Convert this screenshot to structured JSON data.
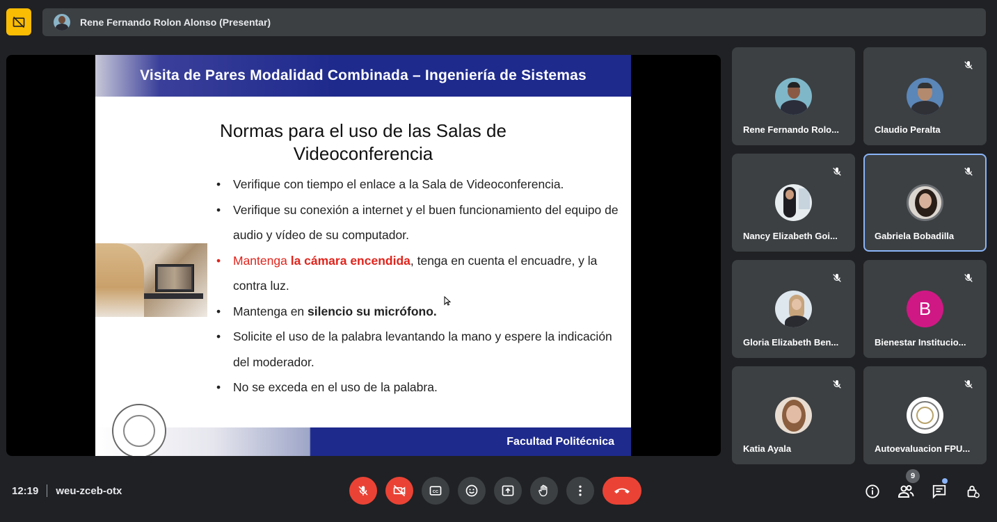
{
  "presenter": {
    "name": "Rene Fernando Rolon Alonso (Presentar)"
  },
  "slide": {
    "header": "Visita de Pares Modalidad Combinada – Ingeniería de Sistemas",
    "title_line1": "Normas para el uso de las Salas de",
    "title_line2": "Videoconferencia",
    "bullets": {
      "b1": "Verifique con tiempo el enlace a la Sala de Videoconferencia.",
      "b2": "Verifique su conexión a internet y el buen funcionamiento del equipo de audio y vídeo de su computador.",
      "b3_part1": "Mantenga ",
      "b3_part2": "la cámara encendida",
      "b3_part3": ", tenga en cuenta el encuadre, y la contra luz.",
      "b4_part1": "Mantenga en ",
      "b4_part2": "silencio su micrófono.",
      "b5": "Solicite el uso de la palabra levantando la mano y espere la indicación del moderador.",
      "b6": "No se exceda en el uso de la palabra."
    },
    "footer": "Facultad Politécnica"
  },
  "participants": [
    {
      "name": "Rene Fernando Rolo...",
      "muted": false
    },
    {
      "name": "Claudio Peralta",
      "muted": true
    },
    {
      "name": "Nancy Elizabeth Goi...",
      "muted": true
    },
    {
      "name": "Gabriela Bobadilla",
      "muted": true
    },
    {
      "name": "Gloria Elizabeth Ben...",
      "muted": true
    },
    {
      "name": "Bienestar Institucio...",
      "muted": true,
      "initial": "B"
    },
    {
      "name": "Katia Ayala",
      "muted": true
    },
    {
      "name": "Autoevaluacion FPU...",
      "muted": true
    }
  ],
  "meeting": {
    "time": "12:19",
    "code": "weu-zceb-otx",
    "people_count": "9"
  },
  "icons": {
    "warn": "camera-off-icon",
    "mic": "mic-off-icon",
    "cam": "videocam-off-icon",
    "cc": "closed-captions-icon",
    "emoji": "emoji-icon",
    "present": "present-screen-icon",
    "hand": "raise-hand-icon",
    "more": "more-vert-icon",
    "end": "call-end-icon",
    "info": "info-icon",
    "people": "people-icon",
    "chat": "chat-icon",
    "lock": "host-controls-icon"
  },
  "colors": {
    "background": "#202124",
    "tile": "#3c4043",
    "red": "#ea4335",
    "accent": "#8ab4f8",
    "slide_blue": "#1e2a8c"
  }
}
